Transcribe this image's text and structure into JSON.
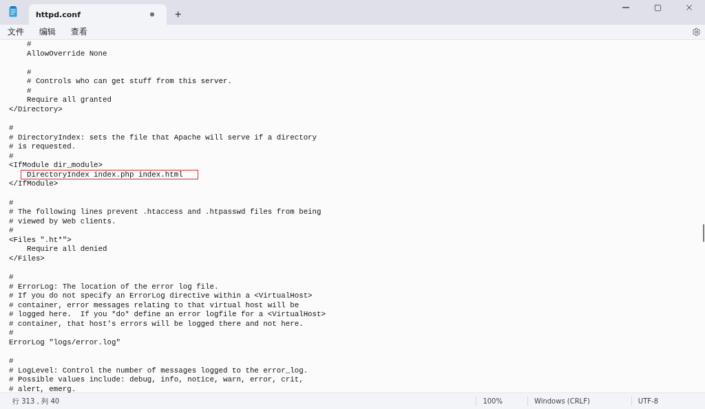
{
  "tab": {
    "title": "httpd.conf",
    "unsaved": true
  },
  "new_tab_button": "+",
  "menu": [
    "文件",
    "编辑",
    "查看"
  ],
  "editor": {
    "lines": [
      {
        "text": "    #",
        "highlighted": false
      },
      {
        "text": "    AllowOverride None",
        "highlighted": false
      },
      {
        "highlighted": false
      },
      {
        "text": "    #",
        "highlighted": false
      },
      {
        "text": "    # Controls who can get stuff from this server.",
        "highlighted": false
      },
      {
        "text": "    #",
        "highlighted": false
      },
      {
        "text": "    Require all granted",
        "highlighted": false
      },
      {
        "text": "</Directory>",
        "highlighted": false
      },
      {
        "highlighted": false
      },
      {
        "text": "#",
        "highlighted": false
      },
      {
        "text": "# DirectoryIndex: sets the file that Apache will serve if a directory",
        "highlighted": false
      },
      {
        "text": "# is requested.",
        "highlighted": false
      },
      {
        "text": "#",
        "highlighted": false
      },
      {
        "text": "<IfModule dir_module>",
        "highlighted": false
      },
      {
        "text": "    DirectoryIndex index.php index.html",
        "highlighted": true
      },
      {
        "text": "</IfModule>",
        "highlighted": false
      },
      {
        "highlighted": false
      },
      {
        "text": "#",
        "highlighted": false
      },
      {
        "text": "# The following lines prevent .htaccess and .htpasswd files from being",
        "highlighted": false
      },
      {
        "text": "# viewed by Web clients.",
        "highlighted": false
      },
      {
        "text": "#",
        "highlighted": false
      },
      {
        "text": "<Files \".ht*\">",
        "highlighted": false
      },
      {
        "text": "    Require all denied",
        "highlighted": false
      },
      {
        "text": "</Files>",
        "highlighted": false
      },
      {
        "highlighted": false
      },
      {
        "text": "#",
        "highlighted": false
      },
      {
        "text": "# ErrorLog: The location of the error log file.",
        "highlighted": false
      },
      {
        "text": "# If you do not specify an ErrorLog directive within a <VirtualHost>",
        "highlighted": false
      },
      {
        "text": "# container, error messages relating to that virtual host will be",
        "highlighted": false
      },
      {
        "text": "# logged here.  If you *do* define an error logfile for a <VirtualHost>",
        "highlighted": false
      },
      {
        "text": "# container, that host's errors will be logged there and not here.",
        "highlighted": false
      },
      {
        "text": "#",
        "highlighted": false
      },
      {
        "text": "ErrorLog \"logs/error.log\"",
        "highlighted": false
      },
      {
        "highlighted": false
      },
      {
        "text": "#",
        "highlighted": false
      },
      {
        "text": "# LogLevel: Control the number of messages logged to the error_log.",
        "highlighted": false
      },
      {
        "text": "# Possible values include: debug, info, notice, warn, error, crit,",
        "highlighted": false
      },
      {
        "text": "# alert, emerg.",
        "highlighted": false
      }
    ]
  },
  "status_bar": {
    "position": "行 313，列 40",
    "zoom": "100%",
    "line_ending": "Windows (CRLF)",
    "encoding": "UTF-8"
  }
}
